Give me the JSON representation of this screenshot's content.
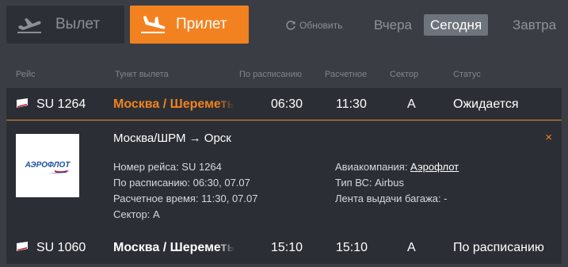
{
  "tabs": {
    "departure": "Вылет",
    "arrival": "Прилет"
  },
  "refresh": "Обновить",
  "days": {
    "yesterday": "Вчера",
    "today": "Сегодня",
    "tomorrow": "Завтра"
  },
  "columns": {
    "flight": "Рейс",
    "origin": "Тункт вылета",
    "scheduled": "По расписанию",
    "estimated": "Расчетное",
    "sector": "Сектор",
    "status": "Статус"
  },
  "flights": [
    {
      "number": "SU 1264",
      "origin": "Москва / Шереметьево",
      "scheduled": "06:30",
      "estimated": "11:30",
      "sector": "A",
      "status": "Ожидается"
    },
    {
      "number": "SU 1060",
      "origin": "Москва / Шереметьево",
      "scheduled": "15:10",
      "estimated": "15:10",
      "sector": "A",
      "status": "По расписанию"
    }
  ],
  "details": {
    "logo_text": "АЭРОФЛОТ",
    "route": "Москва/ШРМ → Орск",
    "close": "×",
    "flight_number": "Номер рейса: SU 1264",
    "scheduled": "По расписанию: 06:30, 07.07",
    "estimated": "Расчетное время: 11:30, 07.07",
    "sector": "Сектор: A",
    "airline_label": "Авиакомпания: ",
    "airline": "Аэрофлот",
    "aircraft": "Тип ВС: Airbus",
    "baggage": "Лента выдачи багажа: -"
  },
  "colors": {
    "accent": "#f28220",
    "background": "#3a3e44",
    "row": "#2b2f35"
  }
}
